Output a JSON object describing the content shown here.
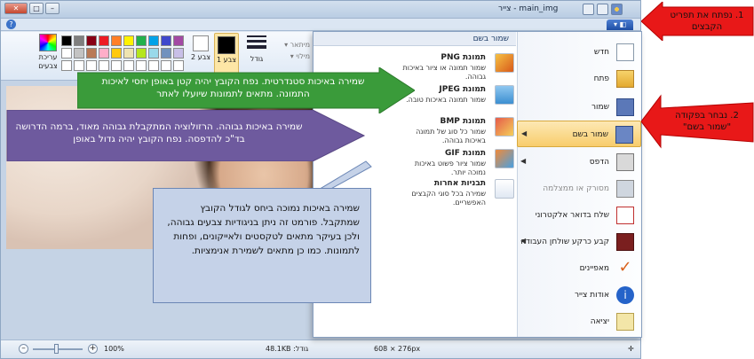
{
  "window": {
    "title": "main_img - צייר",
    "file_button_label": "▾ ◧"
  },
  "ribbon": {
    "edit_colors_label": "עריכת צבעים",
    "color2_label": "צבע 2",
    "color1_label": "צבע 1",
    "size_label": "גודל",
    "outline_label": "מיתאר ▾",
    "fill_label": "מילוי ▾",
    "palette": [
      "#000000",
      "#7f7f7f",
      "#880015",
      "#ed1c24",
      "#ff7f27",
      "#fff200",
      "#22b14c",
      "#00a2e8",
      "#3f48cc",
      "#a349a4",
      "#ffffff",
      "#c3c3c3",
      "#b97a57",
      "#ffaec9",
      "#ffc90e",
      "#efe4b0",
      "#b5e61d",
      "#99d9ea",
      "#7092be",
      "#c8bfe7",
      "#ffffff",
      "#ffffff",
      "#ffffff",
      "#ffffff",
      "#ffffff",
      "#ffffff",
      "#ffffff",
      "#ffffff",
      "#ffffff",
      "#ffffff"
    ]
  },
  "file_menu": {
    "items": [
      {
        "label": "חדש",
        "icon": "new-file-icon",
        "arrow": false
      },
      {
        "label": "פתח",
        "icon": "open-folder-icon",
        "arrow": false
      },
      {
        "label": "שמור",
        "icon": "save-icon",
        "arrow": false
      },
      {
        "label": "שמור בשם",
        "icon": "save-as-icon",
        "arrow": true
      },
      {
        "label": "הדפס",
        "icon": "printer-icon",
        "arrow": true
      },
      {
        "label": "מסורק או ממצלמה",
        "icon": "scanner-icon",
        "arrow": false
      },
      {
        "label": "שלח בדואר אלקטרוני",
        "icon": "email-icon",
        "arrow": false
      },
      {
        "label": "קבע כרקע שולחן העבודה",
        "icon": "desktop-icon",
        "arrow": true
      },
      {
        "label": "מאפיינים",
        "icon": "check-icon",
        "arrow": false
      },
      {
        "label": "אודות צייר",
        "icon": "info-icon",
        "arrow": false
      },
      {
        "label": "יציאה",
        "icon": "exit-icon",
        "arrow": false
      }
    ],
    "save_as_header": "שמור בשם",
    "save_as_options": [
      {
        "title": "תמונת PNG",
        "desc": "שמור תמונה או ציור באיכות גבוהה."
      },
      {
        "title": "תמונת JPEG",
        "desc": "שמור תמונה באיכות טובה."
      },
      {
        "title": "תמונת BMP",
        "desc": "שמור כל סוג של תמונה באיכות גבוהה."
      },
      {
        "title": "תמונת GIF",
        "desc": "שמור ציור פשוט באיכות נמוכה יותר."
      },
      {
        "title": "תבניות אחרות",
        "desc": "שמירה בכל סוגי הקבצים האפשריים."
      }
    ]
  },
  "status": {
    "zoom": "100%",
    "size_label": "גודל: 48.1KB",
    "dimensions": "608 × 276px"
  },
  "annotations": {
    "red_1": "1. נפתח את תפריט הקבצים",
    "red_2": "2. נבחר בפקודה \"שמור בשם\"",
    "green": "שמירה באיכות סטנדרטית. נפח הקובץ יהיה קטן באופן יחסי לאיכות התמונה. מתאים לתמונות שיועלו לאתר",
    "purple": "שמירה באיכות גבוהה. הרזולוציה המתקבלת גבוהה מאוד, ברמה הדרושה בד\"כ להדפסה. נפח הקובץ יהיה גדול באופן",
    "blue": "שמירה באיכות נמוכה ביחס לגודל הקובץ שמתקבל. פורמט זה ניתן בניגודיות צבעים גבוהה, ולכן בעיקר מתאים לטקסטים ולאייקונים, ופחות לתמונות. כמו כן מתאים לשמירת אנימציות."
  },
  "colors": {
    "green_callout": "#3a9b3a",
    "purple_callout": "#6e5a9e",
    "blue_callout": "#c5d2e8",
    "red_callout": "#e81818",
    "menu_highlight": "#f8cd6c"
  }
}
